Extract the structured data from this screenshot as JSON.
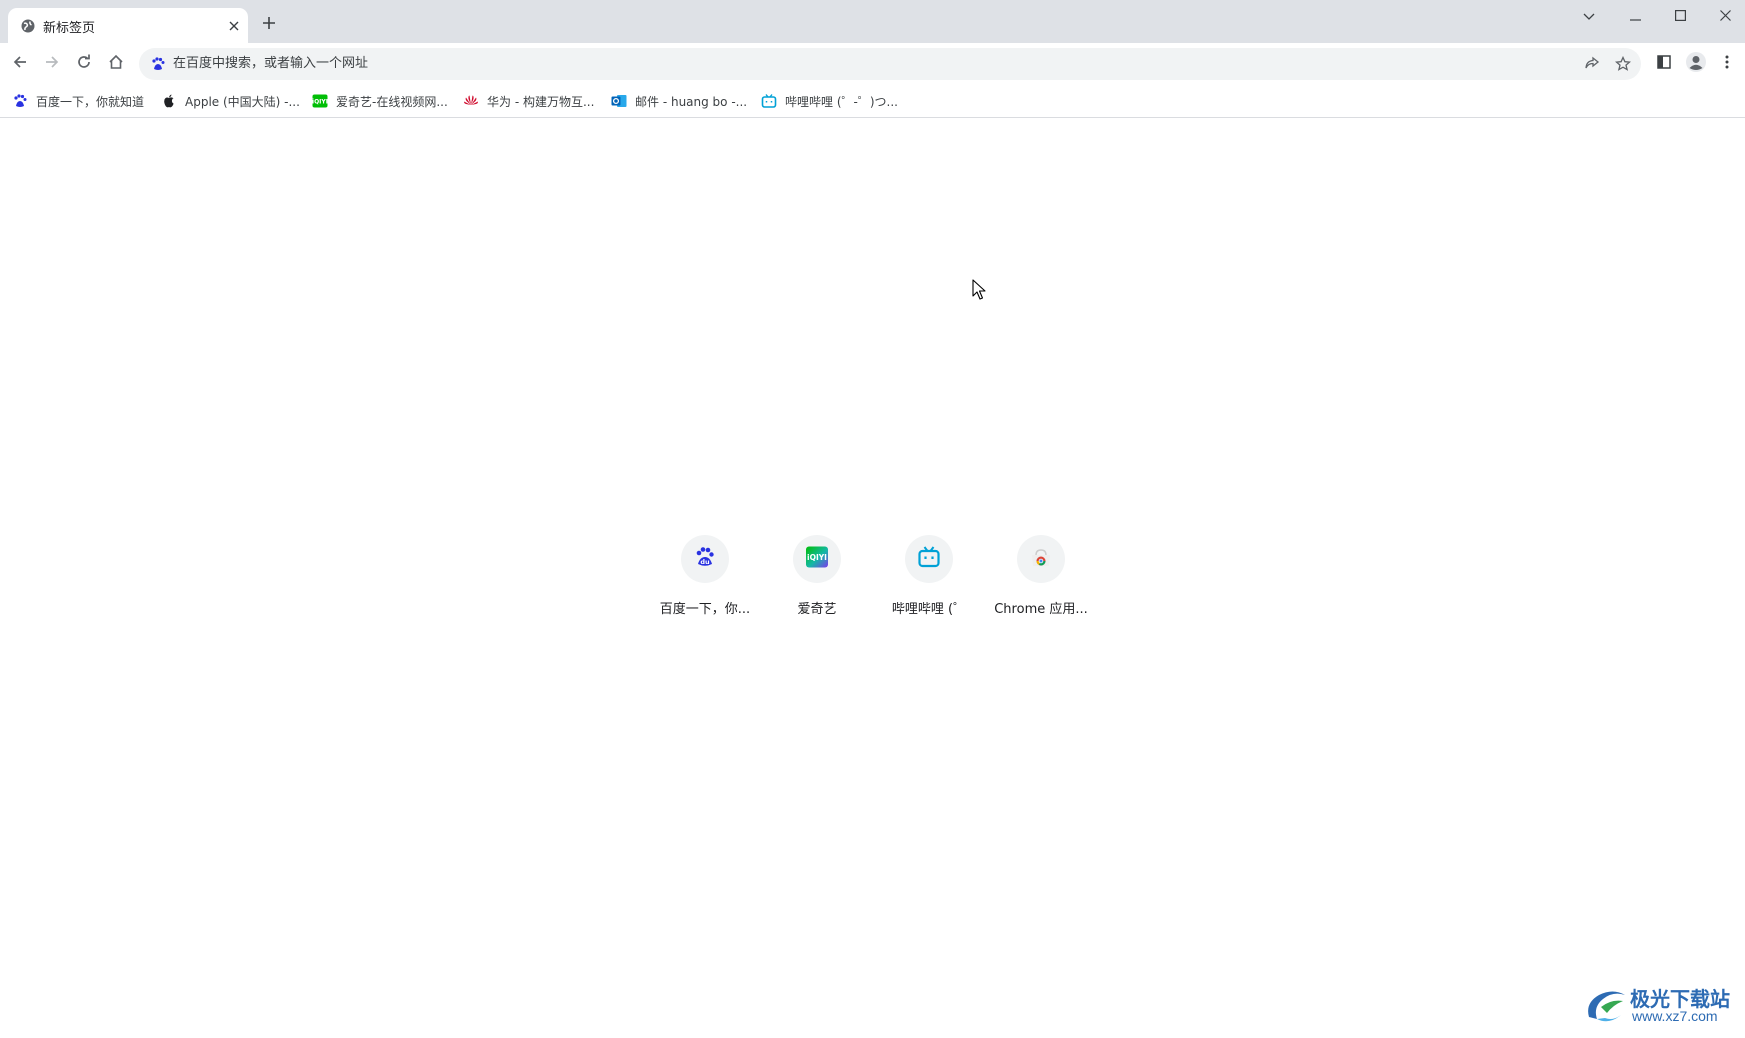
{
  "browser": {
    "tab": {
      "title": "新标签页",
      "favicon": "globe-icon"
    },
    "new_tab_icon": "plus-icon",
    "window_controls": [
      "tab-search-icon",
      "minimize-icon",
      "maximize-icon",
      "close-icon"
    ]
  },
  "toolbar": {
    "nav_icons": [
      "back-arrow-icon",
      "forward-arrow-icon",
      "reload-icon",
      "home-icon"
    ],
    "omnibox": {
      "placeholder": "在百度中搜索，或者输入一个网址",
      "search_engine_icon": "baidu-icon"
    },
    "omnibox_actions": [
      "share-icon",
      "bookmark-star-icon"
    ],
    "right_icons": [
      "side-panel-icon",
      "profile-avatar-icon",
      "more-menu-icon"
    ]
  },
  "bookmarks": [
    {
      "label": "百度一下，你就知道",
      "icon": "baidu-icon"
    },
    {
      "label": "Apple (中国大陆) -...",
      "icon": "apple-icon"
    },
    {
      "label": "爱奇艺-在线视频网...",
      "icon": "iqiyi-icon"
    },
    {
      "label": "华为 - 构建万物互...",
      "icon": "huawei-icon"
    },
    {
      "label": "邮件 - huang bo -...",
      "icon": "outlook-icon"
    },
    {
      "label": "哔哩哔哩 (゜-゜)つ...",
      "icon": "bilibili-icon"
    }
  ],
  "shortcuts": [
    {
      "label": "百度一下，你...",
      "icon": "baidu-icon"
    },
    {
      "label": "爱奇艺",
      "icon": "iqiyi-icon"
    },
    {
      "label": "哔哩哔哩 (゜",
      "icon": "bilibili-icon"
    },
    {
      "label": "Chrome 应用...",
      "icon": "chrome-web-store-icon"
    }
  ],
  "colors": {
    "tabstrip": "#dee1e6",
    "omnibox": "#f1f3f4",
    "baidu": "#2932e1",
    "bilibili": "#00a1d6",
    "huawei": "#cf0a2c",
    "outlook": "#0364b8",
    "watermark": "#2d6bb3"
  },
  "watermark": {
    "title": "极光下载站",
    "url": "www.xz7.com"
  }
}
